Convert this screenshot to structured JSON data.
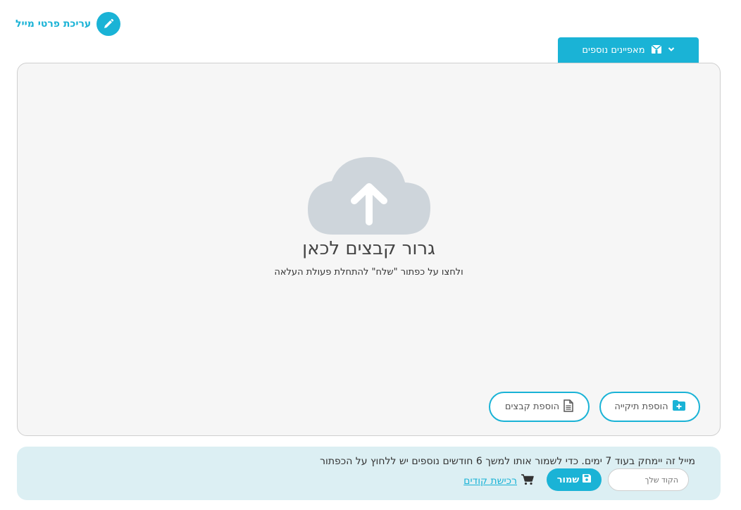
{
  "header": {
    "edit_label": "עריכת פרטי מייל",
    "features_tab": "מאפיינים נוספים"
  },
  "dropzone": {
    "title": "גרור קבצים לכאן",
    "subtitle": "ולחצו על כפתור \"שלח\" להתחלת פעולת העלאה",
    "add_folder": "הוספת תיקייה",
    "add_files": "הוספת קבצים"
  },
  "notice": {
    "text": "מייל זה יימחק בעוד 7 ימים. כדי לשמור אותו למשך 6 חודשים נוספים יש ללחוץ על הכפתור",
    "code_placeholder": "הקוד שלך",
    "save_label": "שמור",
    "buy_codes": "רכישת קודים"
  },
  "colors": {
    "accent": "#1ab3d6",
    "cloud": "#ced5db",
    "notice_bg": "#dceff3"
  }
}
